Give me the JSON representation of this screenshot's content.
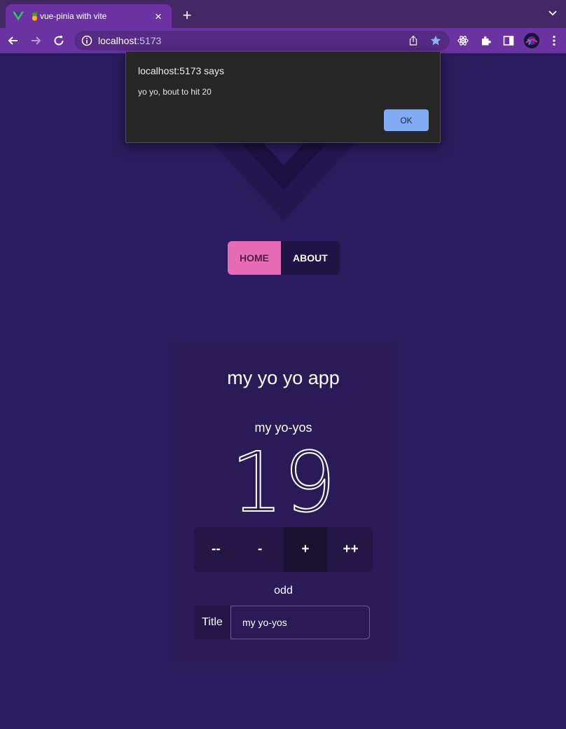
{
  "browser": {
    "tab_title": "🍍vue-pinia with vite",
    "new_tab_label": "+",
    "close_tab_label": "×",
    "url_host": "localhost",
    "url_port": ":5173"
  },
  "nav": {
    "home": "HOME",
    "about": "ABOUT",
    "active": "HOME"
  },
  "app": {
    "title": "my yo yo app",
    "counter_title": "my yo-yos",
    "count": "19",
    "parity": "odd",
    "buttons": {
      "decrement_twice": "--",
      "decrement": "-",
      "increment": "+",
      "increment_twice": "++"
    },
    "title_field": {
      "label": "Title",
      "value": "my yo-yos"
    }
  },
  "dialog": {
    "heading": "localhost:5173 says",
    "message": "yo yo, bout to hit 20",
    "ok_label": "OK"
  },
  "colors": {
    "page_bg": "#2a1b5e",
    "card_bg": "#2b1a58",
    "nav_active": "#e86bb8",
    "chrome_tab": "#6b33a2",
    "dialog_button": "#82aaf0"
  },
  "icons": [
    "vue-favicon",
    "close-icon",
    "plus-icon",
    "chevron-down-icon",
    "back-icon",
    "forward-icon",
    "reload-icon",
    "info-icon",
    "share-icon",
    "star-icon",
    "react-devtools-icon",
    "extensions-icon",
    "sidepanel-icon",
    "profile-avatar",
    "kebab-menu-icon",
    "vue-logo"
  ]
}
